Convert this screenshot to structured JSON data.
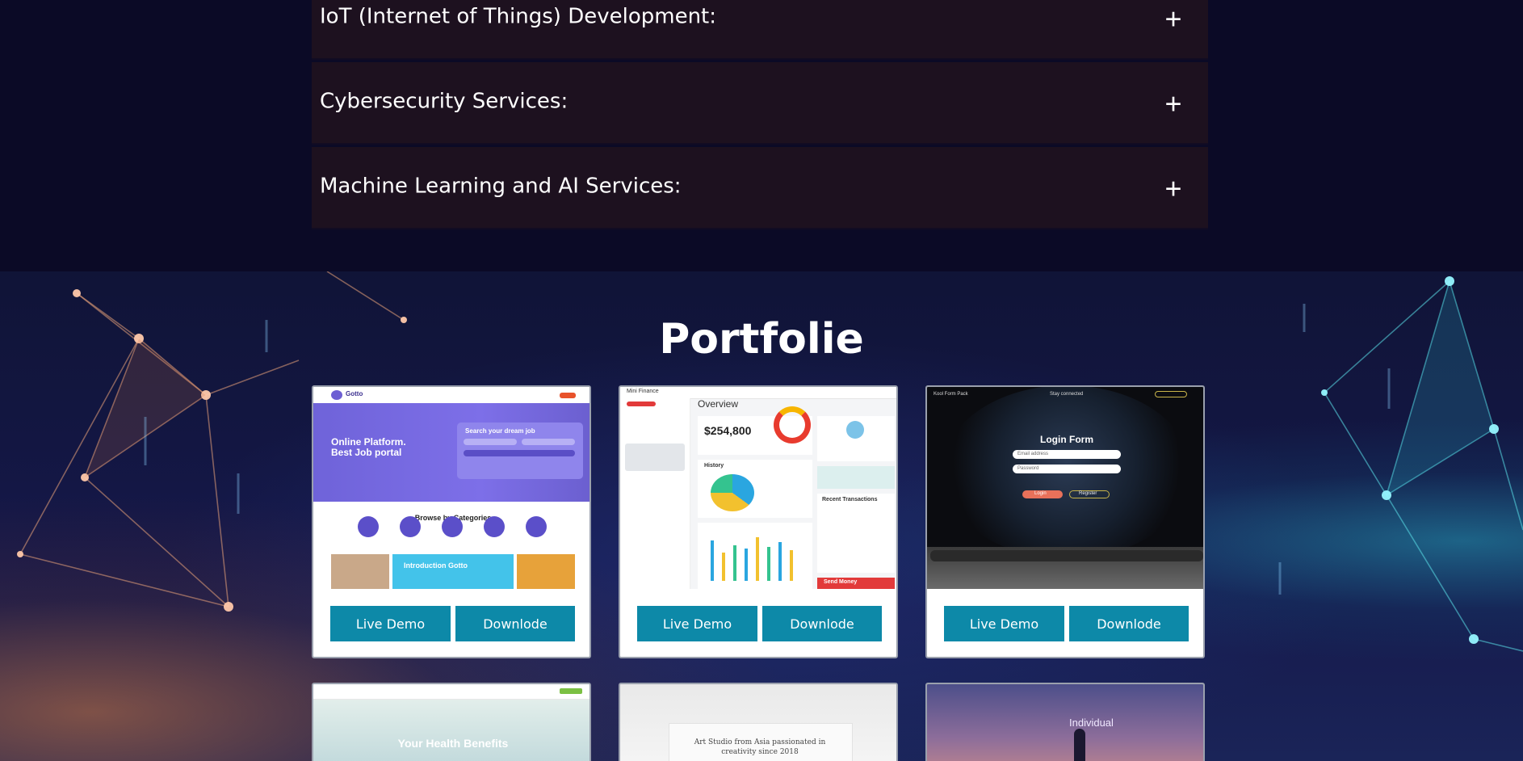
{
  "services": [
    {
      "label": "IoT (Internet of Things) Development:",
      "toggle": "+"
    },
    {
      "label": "Cybersecurity Services:",
      "toggle": "+"
    },
    {
      "label": "Machine Learning and AI Services:",
      "toggle": "+"
    }
  ],
  "portfolio": {
    "title": "Portfolie",
    "cards": [
      {
        "demo_label": "Live Demo",
        "download_label": "Downlode",
        "thumb": {
          "headline": "Online Platform.\nBest Job portal",
          "search_title": "Search your dream job",
          "section": "Browse by Categories",
          "promo": "Introduction Gotto",
          "brand": "Gotto"
        }
      },
      {
        "demo_label": "Live Demo",
        "download_label": "Downlode",
        "thumb": {
          "app": "Mini Finance",
          "heading": "Overview",
          "amount": "$254,800",
          "history": "History",
          "transactions": "Recent Transactions",
          "send": "Send Money"
        }
      },
      {
        "demo_label": "Live Demo",
        "download_label": "Downlode",
        "thumb": {
          "brand": "Kool Form Pack",
          "status": "Stay connected",
          "form_title": "Login Form",
          "email_ph": "Email address",
          "password_ph": "Password",
          "login": "Login",
          "register": "Register"
        }
      }
    ],
    "bottom_cards": [
      {
        "thumb_text": "Your Health Benefits"
      },
      {
        "thumb_text": "Art Studio from Asia passionated in creativity since 2018"
      },
      {
        "thumb_text": "Individual"
      }
    ]
  },
  "colors": {
    "button": "#0d89a8",
    "accordion_bg": "#1d111f",
    "page_bg": "#0b0a26"
  }
}
